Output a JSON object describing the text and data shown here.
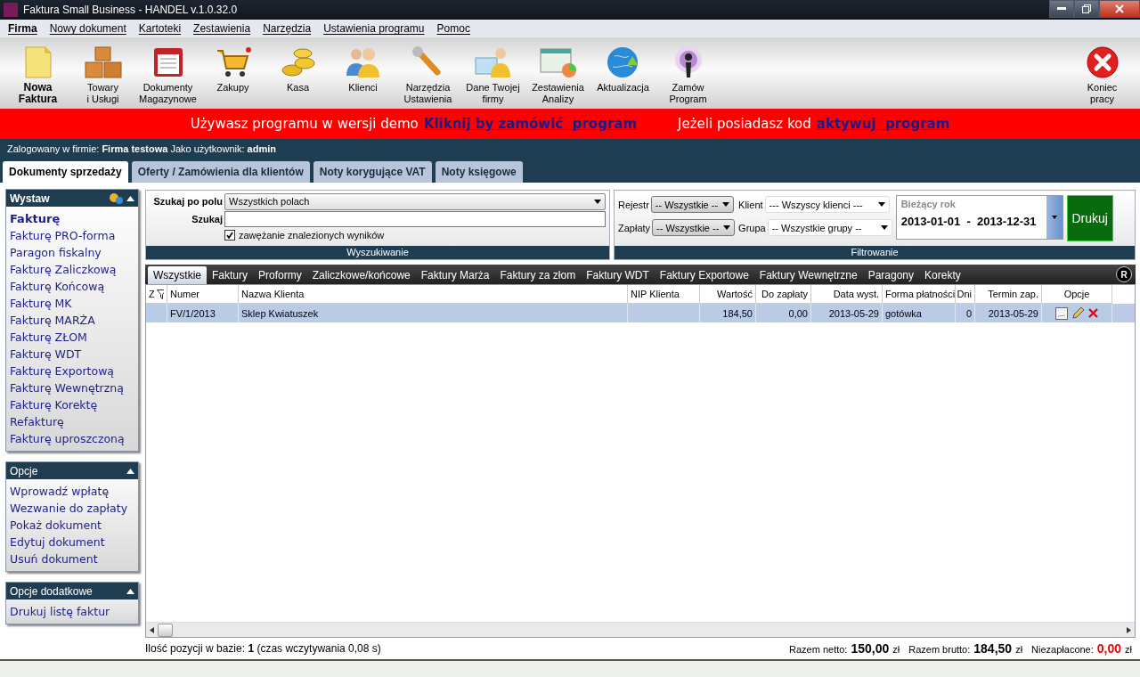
{
  "window": {
    "title": "Faktura Small Business - HANDEL v.1.0.32.0"
  },
  "menu": [
    {
      "label": "Firma",
      "selected": true
    },
    {
      "label": "Nowy dokument",
      "selected": false
    },
    {
      "label": "Kartoteki",
      "selected": false
    },
    {
      "label": "Zestawienia",
      "selected": false
    },
    {
      "label": "Narzędzia",
      "selected": false
    },
    {
      "label": "Ustawienia programu",
      "selected": false
    },
    {
      "label": "Pomoc",
      "selected": false
    }
  ],
  "toolbar": [
    {
      "lines": [
        "Nowa",
        "Faktura"
      ],
      "kind": "primary"
    },
    {
      "lines": [
        "Towary",
        "i Usługi"
      ],
      "kind": "normal"
    },
    {
      "lines": [
        "Dokumenty",
        "Magazynowe"
      ],
      "kind": "normal"
    },
    {
      "lines": [
        "Zakupy"
      ],
      "kind": "normal"
    },
    {
      "lines": [
        "Kasa"
      ],
      "kind": "normal"
    },
    {
      "lines": [
        "Klienci"
      ],
      "kind": "normal"
    },
    {
      "lines": [
        "Narzędzia",
        "Ustawienia"
      ],
      "kind": "normal"
    },
    {
      "lines": [
        "Dane Twojej",
        "firmy"
      ],
      "kind": "normal"
    },
    {
      "lines": [
        "Zestawienia",
        "Analizy"
      ],
      "kind": "normal"
    },
    {
      "lines": [
        "Aktualizacja"
      ],
      "kind": "normal"
    },
    {
      "lines": [
        "Zamów",
        "Program"
      ],
      "kind": "normal"
    },
    {
      "lines": [
        "Koniec",
        "pracy"
      ],
      "kind": "exit"
    }
  ],
  "banner": {
    "text": "Używasz programu w wersji demo",
    "link": "Kliknij by zamówić  program",
    "text_2": "Jeżeli posiadasz kod",
    "link_2": "aktywuj  program"
  },
  "session": "Zalogowany w firmie: **Firma testowa** Jako użytkownik: **admin**",
  "tabs": [
    {
      "label": "Dokumenty sprzedaży",
      "selected": true
    },
    {
      "label": "Oferty / Zamówienia dla klientów",
      "selected": false
    },
    {
      "label": "Noty korygujące VAT",
      "selected": false
    },
    {
      "label": "Noty księgowe",
      "selected": false
    }
  ],
  "sidebar": [
    {
      "title": "Wystaw",
      "items": [
        {
          "label": "Fakturę",
          "selected": true
        },
        {
          "label": "Fakturę PRO-forma",
          "selected": false
        },
        {
          "label": "Paragon fiskalny",
          "selected": false
        },
        {
          "label": "Fakturę Zaliczkową",
          "selected": false
        },
        {
          "label": "Fakturę Końcową",
          "selected": false
        },
        {
          "label": "Fakturę MK",
          "selected": false
        },
        {
          "label": "Fakturę MARŻA",
          "selected": false
        },
        {
          "label": "Fakturę ZŁOM",
          "selected": false
        },
        {
          "label": "Fakturę WDT",
          "selected": false
        },
        {
          "label": "Fakturę Exportową",
          "selected": false
        },
        {
          "label": "Fakturę Wewnętrzną",
          "selected": false
        },
        {
          "label": "Fakturę Korektę",
          "selected": false
        },
        {
          "label": "Refakturę",
          "selected": false
        },
        {
          "label": "Fakturę uproszczoną",
          "selected": false
        }
      ]
    },
    {
      "title": "Opcje",
      "items": [
        {
          "label": "Wprowadź wpłatę",
          "selected": false
        },
        {
          "label": "Wezwanie do zapłaty",
          "selected": false
        },
        {
          "label": "Pokaż dokument",
          "selected": false
        },
        {
          "label": "Edytuj dokument",
          "selected": false
        },
        {
          "label": "Usuń dokument",
          "selected": false
        }
      ]
    },
    {
      "title": "Opcje dodatkowe",
      "items": [
        {
          "label": "Drukuj listę faktur",
          "selected": false
        }
      ]
    }
  ],
  "search": {
    "field_label": "Szukaj po polu",
    "field_value": "Wszystkich polach",
    "search_label": "Szukaj",
    "narrow": {
      "label": "zawężanie znalezionych wyników",
      "checked": true
    },
    "caption": "Wyszukiwanie"
  },
  "filter": {
    "register_label": "Rejestr",
    "register_value": "-- Wszystkie --",
    "payment_label": "Zapłaty",
    "payment_value": "-- Wszystkie --",
    "client_label": "Klient",
    "client_value": "--- Wszyscy klienci ---",
    "group_label": "Grupa",
    "group_value": "-- Wszystkie grupy --",
    "period_label": "Bieżący rok",
    "period_value": "2013-01-01  -  2013-12-31",
    "print": "Drukuj",
    "caption": "Filtrowanie"
  },
  "doc_tabs": [
    {
      "label": "Wszystkie",
      "selected": true
    },
    {
      "label": "Faktury",
      "selected": false
    },
    {
      "label": "Proformy",
      "selected": false
    },
    {
      "label": "Zaliczkowe/końcowe",
      "selected": false
    },
    {
      "label": "Faktury Marża",
      "selected": false
    },
    {
      "label": "Faktury za złom",
      "selected": false
    },
    {
      "label": "Faktury WDT",
      "selected": false
    },
    {
      "label": "Faktury Exportowe",
      "selected": false
    },
    {
      "label": "Faktury Wewnętrzne",
      "selected": false
    },
    {
      "label": "Paragony",
      "selected": false
    },
    {
      "label": "Korekty",
      "selected": false
    }
  ],
  "doc_tabs_badge": "R",
  "table": {
    "columns": [
      "Z",
      "Numer",
      "Nazwa Klienta",
      "NIP Klienta",
      "Wartość",
      "Do zapłaty",
      "Data wyst.",
      "Forma płatności",
      "Dni",
      "Termin zap.",
      "Opcje"
    ],
    "rows": [
      {
        "number": "FV/1/2013",
        "client": "Sklep Kwiatuszek",
        "value": "184,50",
        "to_pay": "0,00",
        "issued": "2013-05-29",
        "payment": "gotówka",
        "days": "0",
        "due": "2013-05-29",
        "selected": true
      }
    ]
  },
  "footer": {
    "count": "Ilość pozycji w bazie: **1** (czas wczytywania 0,08 s)",
    "totals": [
      {
        "label": "Razem netto:",
        "value": "150,00",
        "unit": "zł",
        "kind": "normal"
      },
      {
        "label": "Razem brutto:",
        "value": "184,50",
        "unit": "zł",
        "kind": "normal"
      },
      {
        "label": "Niezapłacone:",
        "value": "0,00",
        "unit": "zł",
        "kind": "alert"
      }
    ]
  }
}
